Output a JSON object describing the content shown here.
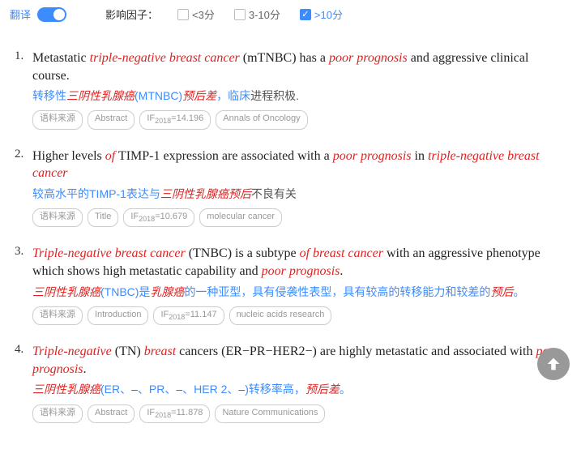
{
  "filter": {
    "translate_label": "翻译",
    "if_label": "影响因子：",
    "options": [
      {
        "label": "<3分",
        "checked": false
      },
      {
        "label": "3-10分",
        "checked": false
      },
      {
        "label": ">10分",
        "checked": true
      }
    ]
  },
  "tag_labels": {
    "source": "语料来源",
    "if_prefix": "IF",
    "if_year": "2018"
  },
  "items": [
    {
      "num": "1.",
      "eng": [
        {
          "t": "Metastatic ",
          "red": false
        },
        {
          "t": "triple-negative breast cancer",
          "red": true
        },
        {
          "t": " (mTNBC) has a ",
          "red": false
        },
        {
          "t": "poor prognosis",
          "red": true
        },
        {
          "t": " and aggressive clinical course.",
          "red": false
        }
      ],
      "cn": [
        {
          "t": "转移性",
          "c": "blue"
        },
        {
          "t": "三阴性乳腺癌",
          "c": "red"
        },
        {
          "t": "(MTNBC)",
          "c": "blue"
        },
        {
          "t": "预后差",
          "c": "red"
        },
        {
          "t": "，临床",
          "c": "blue"
        },
        {
          "t": "进程积极.",
          "c": "dark"
        }
      ],
      "section": "Abstract",
      "if_value": "=14.196",
      "journal": "Annals of Oncology"
    },
    {
      "num": "2.",
      "eng": [
        {
          "t": "Higher levels ",
          "red": false
        },
        {
          "t": "of",
          "red": true
        },
        {
          "t": " TIMP-1 expression are associated with a ",
          "red": false
        },
        {
          "t": "poor prognosis",
          "red": true
        },
        {
          "t": " in ",
          "red": false
        },
        {
          "t": "triple-negative breast cancer",
          "red": true
        }
      ],
      "cn": [
        {
          "t": "较高水平的TIMP-1表达与",
          "c": "blue"
        },
        {
          "t": "三阴性乳腺癌预后",
          "c": "red"
        },
        {
          "t": "不良有关",
          "c": "dark"
        }
      ],
      "section": "Title",
      "if_value": "=10.679",
      "journal": "molecular cancer"
    },
    {
      "num": "3.",
      "eng": [
        {
          "t": "Triple-negative breast cancer",
          "red": true
        },
        {
          "t": " (TNBC) is a subtype ",
          "red": false
        },
        {
          "t": "of breast cancer",
          "red": true
        },
        {
          "t": " with an aggressive phenotype which shows high metastatic capability and ",
          "red": false
        },
        {
          "t": "poor prognosis",
          "red": true
        },
        {
          "t": ".",
          "red": false
        }
      ],
      "cn": [
        {
          "t": "三阴性乳腺癌",
          "c": "red"
        },
        {
          "t": "(TNBC)是",
          "c": "blue"
        },
        {
          "t": "乳腺癌",
          "c": "red"
        },
        {
          "t": "的一种亚型，具有侵袭性表型，具有较高的转移能力和较差的",
          "c": "blue"
        },
        {
          "t": "预后",
          "c": "red"
        },
        {
          "t": "。",
          "c": "blue"
        }
      ],
      "section": "Introduction",
      "if_value": "=11.147",
      "journal": "nucleic acids research"
    },
    {
      "num": "4.",
      "eng": [
        {
          "t": "Triple-negative",
          "red": true
        },
        {
          "t": " (TN) ",
          "red": false
        },
        {
          "t": "breast",
          "red": true
        },
        {
          "t": " cancers (ER−PR−HER2−) are highly metastatic and associated with ",
          "red": false
        },
        {
          "t": "poor prognosis",
          "red": true
        },
        {
          "t": ".",
          "red": false
        }
      ],
      "cn": [
        {
          "t": "三阴性乳腺癌",
          "c": "red"
        },
        {
          "t": "(ER、",
          "c": "blue"
        },
        {
          "t": "–",
          "c": "red"
        },
        {
          "t": "、PR、",
          "c": "blue"
        },
        {
          "t": "–",
          "c": "red"
        },
        {
          "t": "、HER 2、",
          "c": "blue"
        },
        {
          "t": "–",
          "c": "red"
        },
        {
          "t": ")转移率高，",
          "c": "blue"
        },
        {
          "t": "预后差",
          "c": "red"
        },
        {
          "t": "。",
          "c": "blue"
        }
      ],
      "section": "Abstract",
      "if_value": "=11.878",
      "journal": "Nature Communications"
    }
  ]
}
